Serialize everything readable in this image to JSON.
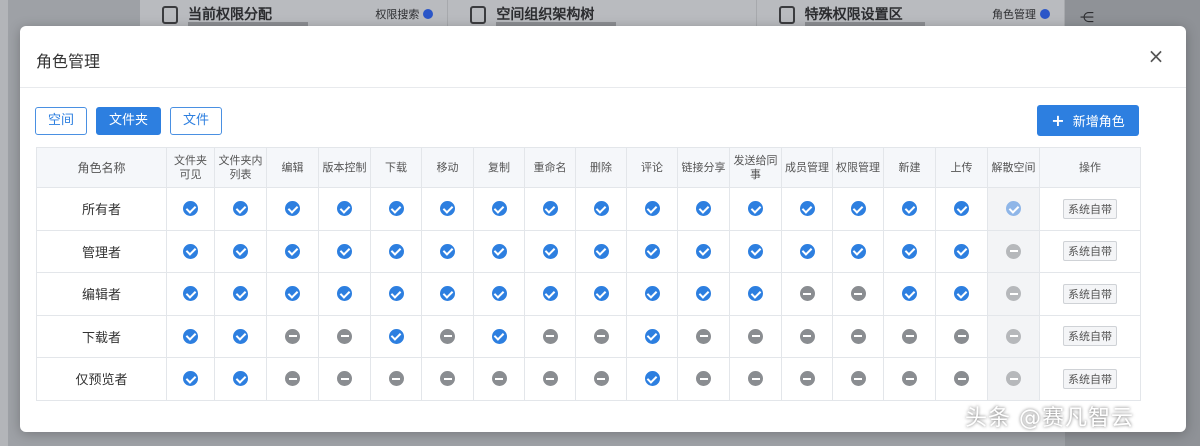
{
  "background": {
    "cards": [
      {
        "title": "当前权限分配",
        "tag": "权限搜索"
      },
      {
        "title": "空间组织架构树",
        "tag": ""
      },
      {
        "title": "特殊权限设置区",
        "tag": "角色管理"
      }
    ]
  },
  "modal": {
    "title": "角色管理",
    "close": "×",
    "tabs": [
      {
        "label": "空间",
        "active": false
      },
      {
        "label": "文件夹",
        "active": true
      },
      {
        "label": "文件",
        "active": false
      }
    ],
    "add_role_label": "新增角色",
    "table": {
      "headers": [
        "角色名称",
        "文件夹可见",
        "文件夹内列表",
        "编辑",
        "版本控制",
        "下载",
        "移动",
        "复制",
        "重命名",
        "删除",
        "评论",
        "链接分享",
        "发送给同事",
        "成员管理",
        "权限管理",
        "新建",
        "上传",
        "解散空间",
        "操作"
      ],
      "rows": [
        {
          "name": "所有者",
          "perms": [
            1,
            1,
            1,
            1,
            1,
            1,
            1,
            1,
            1,
            1,
            1,
            1,
            1,
            1,
            1,
            1,
            1
          ],
          "action": "系统自带"
        },
        {
          "name": "管理者",
          "perms": [
            1,
            1,
            1,
            1,
            1,
            1,
            1,
            1,
            1,
            1,
            1,
            1,
            1,
            1,
            1,
            1,
            0
          ],
          "action": "系统自带"
        },
        {
          "name": "编辑者",
          "perms": [
            1,
            1,
            1,
            1,
            1,
            1,
            1,
            1,
            1,
            1,
            1,
            1,
            0,
            0,
            1,
            1,
            0
          ],
          "action": "系统自带"
        },
        {
          "name": "下载者",
          "perms": [
            1,
            1,
            0,
            0,
            1,
            0,
            1,
            0,
            0,
            1,
            0,
            0,
            0,
            0,
            0,
            0,
            0
          ],
          "action": "系统自带"
        },
        {
          "name": "仅预览者",
          "perms": [
            1,
            1,
            0,
            0,
            0,
            0,
            0,
            0,
            0,
            1,
            0,
            0,
            0,
            0,
            0,
            0,
            0
          ],
          "action": "系统自带"
        }
      ]
    }
  },
  "watermark": "头条 @赛凡智云",
  "colors": {
    "accent": "#2d7fe0",
    "deny": "#8a8d91"
  }
}
